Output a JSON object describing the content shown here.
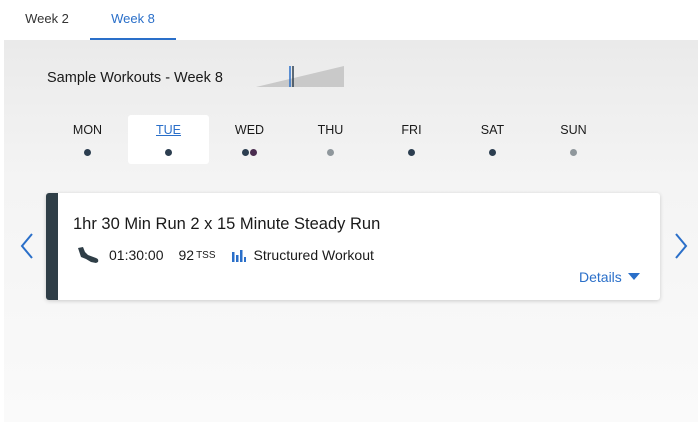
{
  "tabs": [
    {
      "label": "Week 2"
    },
    {
      "label": "Week 8"
    }
  ],
  "plan": {
    "title": "Sample Workouts - Week 8"
  },
  "days": [
    {
      "label": "MON",
      "dots": [
        "#2c3e50"
      ]
    },
    {
      "label": "TUE",
      "dots": [
        "#2c3e50"
      ]
    },
    {
      "label": "WED",
      "dots": [
        "#2c3e50",
        "#4a2c4f"
      ]
    },
    {
      "label": "THU",
      "dots": [
        "#8f979c"
      ]
    },
    {
      "label": "FRI",
      "dots": [
        "#2c3e50"
      ]
    },
    {
      "label": "SAT",
      "dots": [
        "#2c3e50"
      ]
    },
    {
      "label": "SUN",
      "dots": [
        "#8f979c"
      ]
    }
  ],
  "selected_day": "TUE",
  "workout": {
    "title": "1hr 30 Min Run 2 x 15 Minute Steady Run",
    "duration": "01:30:00",
    "tss_value": "92",
    "tss_unit": "TSS",
    "type_label": "Structured Workout",
    "sport_icon": "run-shoe-icon",
    "type_icon": "bar-chart-icon",
    "details_label": "Details"
  },
  "colors": {
    "accent": "#2a6fc9",
    "card_bar": "#2f3e47",
    "dot_planned": "#2c3e50",
    "dot_rest": "#8f979c"
  }
}
